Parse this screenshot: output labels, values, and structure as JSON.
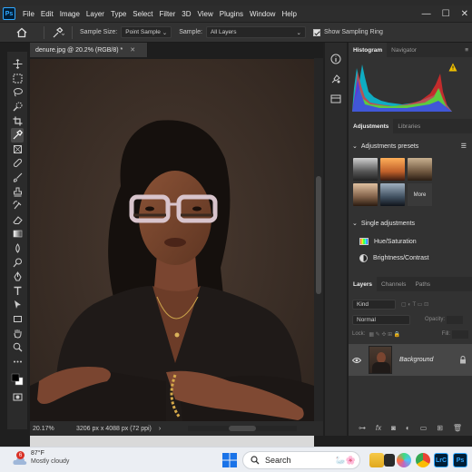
{
  "menubar": {
    "logo": "Ps",
    "items": [
      "File",
      "Edit",
      "Image",
      "Layer",
      "Type",
      "Select",
      "Filter",
      "3D",
      "View",
      "Plugins",
      "Window",
      "Help"
    ]
  },
  "options": {
    "sample_size_label": "Sample Size:",
    "sample_size_value": "Point Sample",
    "sample_label": "Sample:",
    "sample_value": "All Layers",
    "show_ring_label": "Show Sampling Ring"
  },
  "document": {
    "tab_title": "denure.jpg @ 20.2% (RGB/8) *",
    "zoom": "20.17%",
    "dimensions": "3206 px x 4088 px (72 ppi)"
  },
  "panels": {
    "histogram_tab": "Histogram",
    "navigator_tab": "Navigator",
    "adjustments_tab": "Adjustments",
    "libraries_tab": "Libraries",
    "presets_heading": "Adjustments presets",
    "more_label": "More",
    "single_heading": "Single adjustments",
    "adjustment_items": [
      "Hue/Saturation",
      "Brightness/Contrast"
    ],
    "layers_tabs": [
      "Layers",
      "Channels",
      "Paths"
    ],
    "kind_label": "Kind",
    "blend_mode": "Normal",
    "opacity_label": "Opacity:",
    "lock_label": "Lock:",
    "fill_label": "Fill:",
    "layer_name": "Background"
  },
  "taskbar": {
    "weather_badge": "6",
    "temperature": "87°F",
    "condition": "Mostly cloudy",
    "search_placeholder": "Search"
  },
  "colors": {
    "accent": "#31a8ff",
    "canvas_background": "#3d3028"
  }
}
